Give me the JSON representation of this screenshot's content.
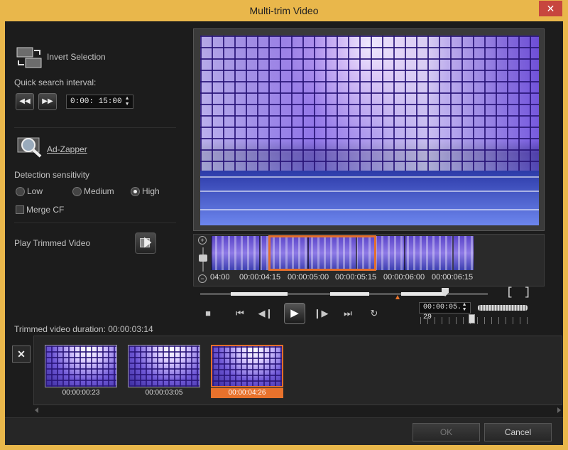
{
  "window": {
    "title": "Multi-trim Video",
    "close_glyph": "✕"
  },
  "left_panel": {
    "invert_selection": "Invert Selection",
    "quick_search_label": "Quick search interval:",
    "quick_search_value": "0:00: 15:00",
    "ad_zapper": "Ad-Zapper",
    "detection_label": "Detection sensitivity",
    "sensitivity_options": [
      {
        "label": "Low",
        "selected": false
      },
      {
        "label": "Medium",
        "selected": false
      },
      {
        "label": "High",
        "selected": true
      }
    ],
    "merge_cf": "Merge CF",
    "merge_cf_checked": false,
    "play_trimmed": "Play Trimmed Video"
  },
  "timeline": {
    "tick_labels": [
      "04:00",
      "00:00:04:15",
      "00:00:05:00",
      "00:00:05:15",
      "00:00:06:00",
      "00:00:06:15"
    ],
    "current_time": "00:00:05. 29"
  },
  "transport": {
    "stop": "■",
    "home": "⏮",
    "prev_frame": "◀❙",
    "play": "▶",
    "next_frame": "❙▶",
    "end": "⏭",
    "repeat": "↻",
    "mark_in": "[",
    "mark_out": "]"
  },
  "trimmed_duration": "Trimmed video duration: 00:00:03:14",
  "clips": [
    {
      "time": "00:00:00:23",
      "selected": false
    },
    {
      "time": "00:00:03:05",
      "selected": false
    },
    {
      "time": "00:00:04:26",
      "selected": true
    }
  ],
  "buttons": {
    "ok": "OK",
    "cancel": "Cancel",
    "delete_glyph": "✕"
  },
  "colors": {
    "accent": "#e8722c",
    "title_bar": "#e9b74b",
    "panel": "#1c1c1c"
  }
}
